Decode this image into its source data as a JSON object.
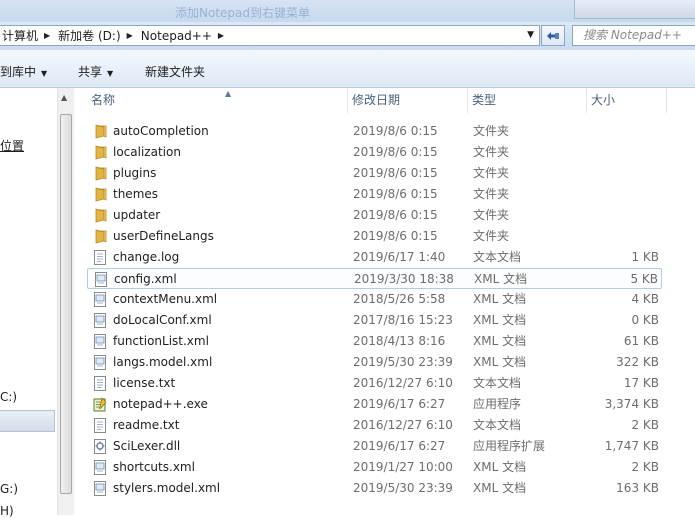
{
  "title_strip_text": "添加Notepad到右键菜单",
  "address": {
    "crumbs": [
      "计算机",
      "新加卷 (D:)",
      "Notepad++"
    ]
  },
  "search": {
    "placeholder": "搜索 Notepad++"
  },
  "toolbar": {
    "include_library_label": "到库中",
    "share_label": "共享",
    "new_folder_label": "新建文件夹"
  },
  "nav": {
    "position_label": "位置",
    "drive_c_label": "C:)",
    "drive_g_label": "G:)",
    "drive_h_label": "H)"
  },
  "columns": {
    "name": "名称",
    "date": "修改日期",
    "type": "类型",
    "size": "大小"
  },
  "files": [
    {
      "name": "autoCompletion",
      "date": "2019/8/6 0:15",
      "type": "文件夹",
      "size": "",
      "icon": "folder-icon"
    },
    {
      "name": "localization",
      "date": "2019/8/6 0:15",
      "type": "文件夹",
      "size": "",
      "icon": "folder-icon"
    },
    {
      "name": "plugins",
      "date": "2019/8/6 0:15",
      "type": "文件夹",
      "size": "",
      "icon": "folder-icon"
    },
    {
      "name": "themes",
      "date": "2019/8/6 0:15",
      "type": "文件夹",
      "size": "",
      "icon": "folder-icon"
    },
    {
      "name": "updater",
      "date": "2019/8/6 0:15",
      "type": "文件夹",
      "size": "",
      "icon": "folder-icon"
    },
    {
      "name": "userDefineLangs",
      "date": "2019/8/6 0:15",
      "type": "文件夹",
      "size": "",
      "icon": "folder-icon"
    },
    {
      "name": "change.log",
      "date": "2019/6/17 1:40",
      "type": "文本文档",
      "size": "1 KB",
      "icon": "text-file-icon"
    },
    {
      "name": "config.xml",
      "date": "2019/3/30 18:38",
      "type": "XML 文档",
      "size": "5 KB",
      "icon": "xml-file-icon"
    },
    {
      "name": "contextMenu.xml",
      "date": "2018/5/26 5:58",
      "type": "XML 文档",
      "size": "4 KB",
      "icon": "xml-file-icon"
    },
    {
      "name": "doLocalConf.xml",
      "date": "2017/8/16 15:23",
      "type": "XML 文档",
      "size": "0 KB",
      "icon": "xml-file-icon"
    },
    {
      "name": "functionList.xml",
      "date": "2018/4/13 8:16",
      "type": "XML 文档",
      "size": "61 KB",
      "icon": "xml-file-icon"
    },
    {
      "name": "langs.model.xml",
      "date": "2019/5/30 23:39",
      "type": "XML 文档",
      "size": "322 KB",
      "icon": "xml-file-icon"
    },
    {
      "name": "license.txt",
      "date": "2016/12/27 6:10",
      "type": "文本文档",
      "size": "17 KB",
      "icon": "text-file-icon"
    },
    {
      "name": "notepad++.exe",
      "date": "2019/6/17 6:27",
      "type": "应用程序",
      "size": "3,374 KB",
      "icon": "notepad-exe-icon"
    },
    {
      "name": "readme.txt",
      "date": "2016/12/27 6:10",
      "type": "文本文档",
      "size": "2 KB",
      "icon": "text-file-icon"
    },
    {
      "name": "SciLexer.dll",
      "date": "2019/6/17 6:27",
      "type": "应用程序扩展",
      "size": "1,747 KB",
      "icon": "dll-file-icon"
    },
    {
      "name": "shortcuts.xml",
      "date": "2019/1/27 10:00",
      "type": "XML 文档",
      "size": "2 KB",
      "icon": "xml-file-icon"
    },
    {
      "name": "stylers.model.xml",
      "date": "2019/5/30 23:39",
      "type": "XML 文档",
      "size": "163 KB",
      "icon": "xml-file-icon"
    }
  ],
  "selected_file": "config.xml"
}
